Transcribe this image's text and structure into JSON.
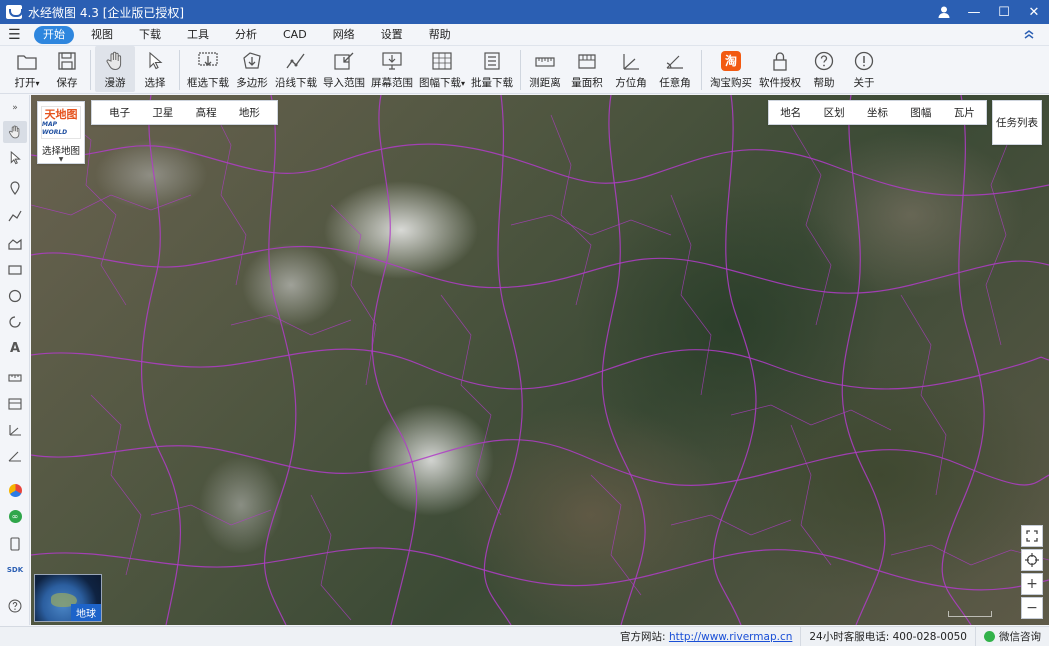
{
  "titlebar": {
    "app_title": "水经微图 4.3 [企业版已授权]",
    "icons": [
      "app-logo-icon",
      "user-icon",
      "minimize-icon",
      "maximize-icon",
      "close-icon"
    ],
    "minimize_glyph": "—",
    "maximize_glyph": "☐",
    "close_glyph": "✕"
  },
  "menubar": {
    "items": [
      {
        "label": "开始",
        "active": true
      },
      {
        "label": "视图"
      },
      {
        "label": "下载"
      },
      {
        "label": "工具"
      },
      {
        "label": "分析"
      },
      {
        "label": "CAD"
      },
      {
        "label": "网络"
      },
      {
        "label": "设置"
      },
      {
        "label": "帮助"
      }
    ]
  },
  "ribbon": {
    "buttons": [
      {
        "label": "打开",
        "icon": "folder-icon",
        "has_dropdown": true
      },
      {
        "label": "保存",
        "icon": "save-icon"
      },
      {
        "label": "漫游",
        "icon": "hand-icon",
        "active": true
      },
      {
        "label": "选择",
        "icon": "pointer-icon"
      },
      {
        "label": "框选下载",
        "icon": "box-download-icon"
      },
      {
        "label": "多边形",
        "icon": "polygon-download-icon"
      },
      {
        "label": "沿线下载",
        "icon": "line-download-icon"
      },
      {
        "label": "导入范围",
        "icon": "import-range-icon"
      },
      {
        "label": "屏幕范围",
        "icon": "screen-range-icon"
      },
      {
        "label": "图幅下载",
        "icon": "sheet-download-icon",
        "has_dropdown": true
      },
      {
        "label": "批量下载",
        "icon": "batch-download-icon"
      },
      {
        "label": "测距离",
        "icon": "ruler-icon"
      },
      {
        "label": "量面积",
        "icon": "area-icon"
      },
      {
        "label": "方位角",
        "icon": "azimuth-icon"
      },
      {
        "label": "任意角",
        "icon": "angle-icon"
      },
      {
        "label": "淘宝购买",
        "icon": "taobao-icon"
      },
      {
        "label": "软件授权",
        "icon": "lock-icon"
      },
      {
        "label": "帮助",
        "icon": "help-icon"
      },
      {
        "label": "关于",
        "icon": "info-icon"
      }
    ],
    "dropdown_glyph": "▾",
    "taobao_glyph": "淘"
  },
  "map": {
    "selector_label": "选择地图",
    "brand_line1": "天地图",
    "brand_line2": "MAP WORLD",
    "base_types": [
      "电子",
      "卫星",
      "高程",
      "地形"
    ],
    "overlays": [
      "地名",
      "区划",
      "坐标",
      "图幅",
      "瓦片"
    ],
    "task_list": "任务列表",
    "globe_label": "地球",
    "zoom_in": "+",
    "zoom_out": "−",
    "colors": {
      "rivers": "#b03cc8",
      "snow": "#eeeeee",
      "terrain_dark": "#3b4a35"
    }
  },
  "statusbar": {
    "site_label": "官方网站:",
    "site_url": "http://www.rivermap.cn",
    "hotline": "24小时客服电话: 400-028-0050",
    "wechat": "微信咨询"
  }
}
